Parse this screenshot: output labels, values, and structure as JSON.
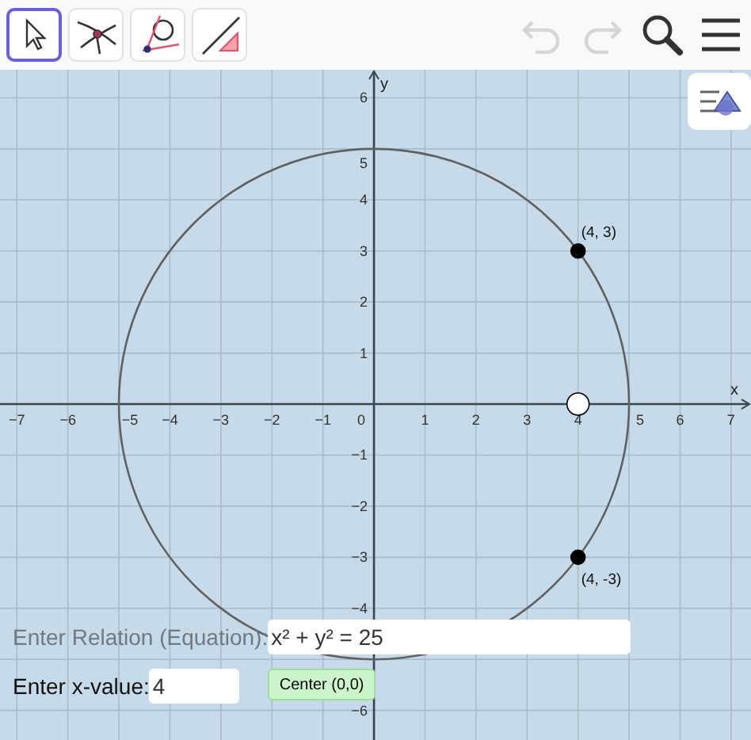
{
  "toolbar": {
    "tools": [
      {
        "kind": "move",
        "selected": true
      },
      {
        "kind": "intersect",
        "selected": false
      },
      {
        "kind": "tangent",
        "selected": false
      },
      {
        "kind": "angle",
        "selected": false
      }
    ],
    "undo": {
      "disabled": true
    },
    "redo": {
      "disabled": true
    }
  },
  "graphics": {
    "x_axis_label": "x",
    "y_axis_label": "y",
    "x_tick_labels": [
      "−7",
      "−6",
      "−5",
      "−4",
      "−3",
      "−2",
      "−1",
      "0",
      "1",
      "2",
      "3",
      "4",
      "5",
      "6",
      "7"
    ],
    "y_tick_labels": [
      "6",
      "5",
      "4",
      "3",
      "2",
      "1",
      "−1",
      "−2",
      "−3",
      "−4",
      "−6"
    ],
    "points": [
      {
        "label": "(4, 3)",
        "filled": true
      },
      {
        "label": "(4, -3)",
        "filled": true
      },
      {
        "filled": false
      }
    ]
  },
  "inputs": [
    {
      "label": "Enter Relation (Equation):",
      "value": "x² + y² = 25",
      "disabled": true
    },
    {
      "label": "Enter x-value:",
      "value": "4",
      "disabled": false
    }
  ],
  "button": {
    "label": "Center (0,0)"
  }
}
